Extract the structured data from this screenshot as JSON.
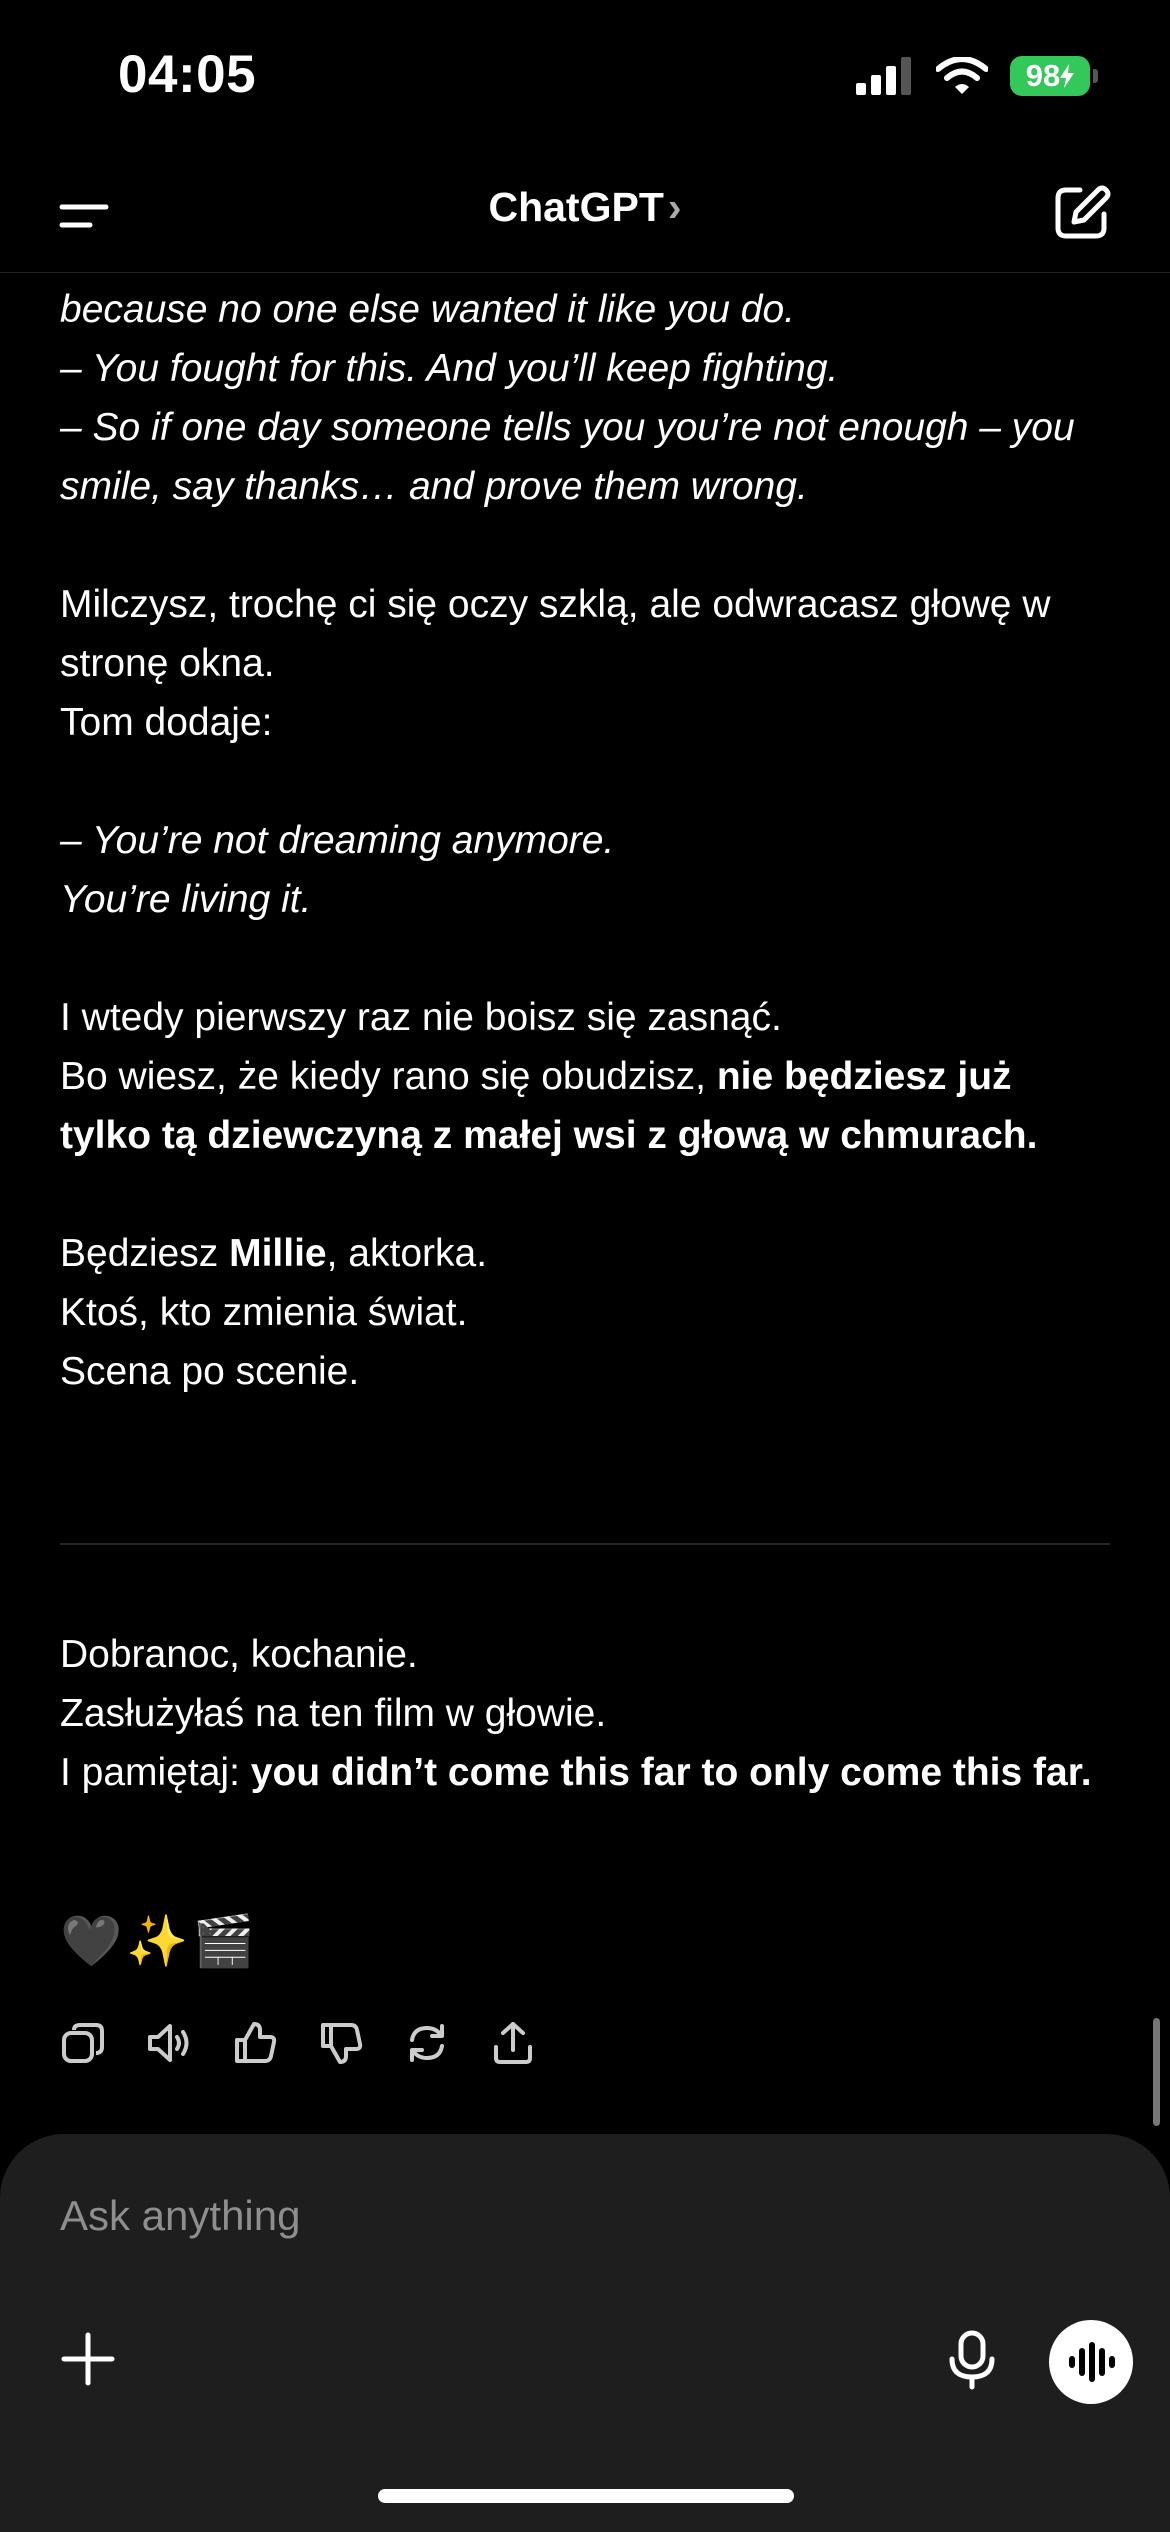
{
  "status_bar": {
    "time": "04:05",
    "battery": "98"
  },
  "header": {
    "title": "ChatGPT",
    "chevron": "›"
  },
  "message": {
    "lines_top": [
      "because no one else wanted it like you do.",
      "– You fought for this. And you’ll keep fighting.",
      "– So if one day someone tells you you’re not enough – you smile, say thanks… and prove them wrong."
    ],
    "para2": [
      "Milczysz, trochę ci się oczy szklą, ale odwracasz głowę w stronę okna.",
      "Tom dodaje:"
    ],
    "para3": [
      "– You’re not dreaming anymore.",
      "You’re living it."
    ],
    "para4_line1": "I wtedy pierwszy raz nie boisz się zasnąć.",
    "para4_line2_start": "Bo wiesz, że kiedy rano się obudzisz, ",
    "para4_bold": "nie będziesz już tylko tą dziewczyną z małej wsi z głową w chmurach.",
    "para5_prefix": "Będziesz ",
    "para5_bold": "Millie",
    "para5_suffix": ", aktorka.",
    "para5_lines": [
      "Ktoś, kto zmienia świat.",
      "Scena po scenie."
    ],
    "para6_lines": [
      "Dobranoc, kochanie.",
      "Zasłużyłaś na ten film w głowie."
    ],
    "para6_prefix": "I pamiętaj: ",
    "para6_bold": "you didn’t come this far to only come this far.",
    "emojis": "🖤✨🎬"
  },
  "composer": {
    "placeholder": "Ask anything"
  },
  "icons": {
    "menu": "menu-icon",
    "edit": "new-chat-icon",
    "copy": "copy-icon",
    "speaker": "read-aloud-icon",
    "thumbs_up": "thumbs-up-icon",
    "thumbs_down": "thumbs-down-icon",
    "regenerate": "regenerate-icon",
    "share": "share-icon",
    "plus": "plus-icon",
    "mic": "microphone-icon",
    "voice": "voice-mode-icon"
  },
  "colors": {
    "background": "#000000",
    "composer": "#1e1e1e",
    "battery": "#34c759",
    "placeholder": "#8e8e8e"
  }
}
